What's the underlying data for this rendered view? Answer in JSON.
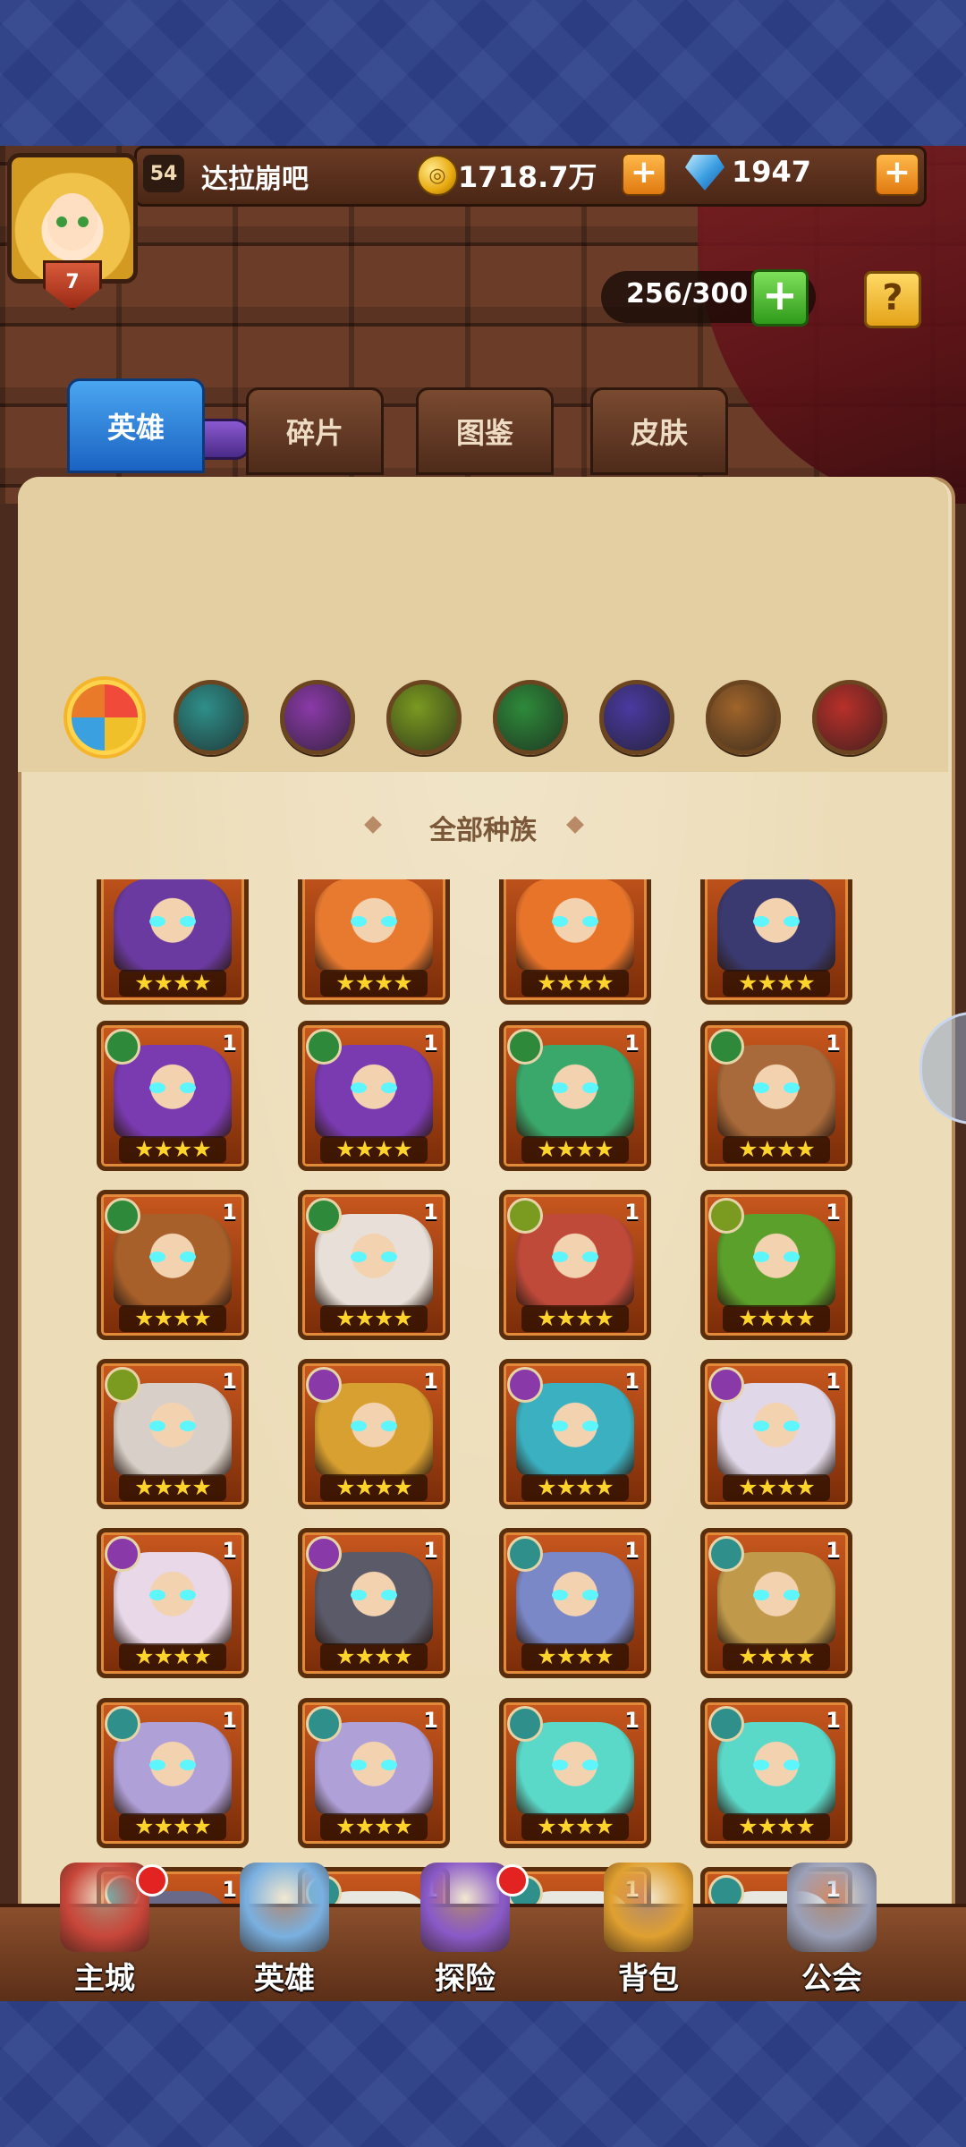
{
  "player": {
    "level": "54",
    "name": "达拉崩吧",
    "vip": "7"
  },
  "currency": {
    "gold": "1718.7万",
    "gems": "1947",
    "add_symbol": "+"
  },
  "hero_capacity": "256/300",
  "help_symbol": "?",
  "tabs": [
    {
      "label": "英雄",
      "active": true
    },
    {
      "label": "碎片",
      "active": false
    },
    {
      "label": "图鉴",
      "active": false
    },
    {
      "label": "皮肤",
      "active": false
    }
  ],
  "race_filters": [
    {
      "name": "all",
      "color": "#f07a2a",
      "selected": true
    },
    {
      "name": "race-1",
      "color": "#2f8f8a",
      "selected": false
    },
    {
      "name": "race-2",
      "color": "#8a3aa8",
      "selected": false
    },
    {
      "name": "race-3",
      "color": "#7a9a20",
      "selected": false
    },
    {
      "name": "race-4",
      "color": "#2e8a3a",
      "selected": false
    },
    {
      "name": "race-5",
      "color": "#4a3aa0",
      "selected": false
    },
    {
      "name": "race-6",
      "color": "#a0642a",
      "selected": false
    },
    {
      "name": "race-7",
      "color": "#b8302a",
      "selected": false
    }
  ],
  "filter_title": "全部种族",
  "hero_rows": [
    [
      {
        "race": "",
        "count": "",
        "stars": "★★★★",
        "color": "#6a3aa0"
      },
      {
        "race": "",
        "count": "",
        "stars": "★★★★",
        "color": "#e87a30"
      },
      {
        "race": "",
        "count": "",
        "stars": "★★★★",
        "color": "#e8742a"
      },
      {
        "race": "",
        "count": "",
        "stars": "★★★★",
        "color": "#3a3a70"
      }
    ],
    [
      {
        "race": "forest",
        "count": "1",
        "stars": "★★★★",
        "color": "#7a3ab0"
      },
      {
        "race": "forest",
        "count": "1",
        "stars": "★★★★",
        "color": "#7a3ab0"
      },
      {
        "race": "forest",
        "count": "1",
        "stars": "★★★★",
        "color": "#3aa86a"
      },
      {
        "race": "forest",
        "count": "1",
        "stars": "★★★★",
        "color": "#a86a3a"
      }
    ],
    [
      {
        "race": "forest",
        "count": "1",
        "stars": "★★★★",
        "color": "#a8602a"
      },
      {
        "race": "forest",
        "count": "1",
        "stars": "★★★★",
        "color": "#e8e0d8"
      },
      {
        "race": "fortress",
        "count": "1",
        "stars": "★★★★",
        "color": "#c04a3a"
      },
      {
        "race": "fortress",
        "count": "1",
        "stars": "★★★★",
        "color": "#5aa02a"
      }
    ],
    [
      {
        "race": "fortress",
        "count": "1",
        "stars": "★★★★",
        "color": "#d8d0c8"
      },
      {
        "race": "abyss",
        "count": "1",
        "stars": "★★★★",
        "color": "#d8a030"
      },
      {
        "race": "abyss",
        "count": "1",
        "stars": "★★★★",
        "color": "#3ab0c0"
      },
      {
        "race": "abyss",
        "count": "1",
        "stars": "★★★★",
        "color": "#e0d8e8"
      }
    ],
    [
      {
        "race": "abyss",
        "count": "1",
        "stars": "★★★★",
        "color": "#e8d8e8"
      },
      {
        "race": "abyss",
        "count": "1",
        "stars": "★★★★",
        "color": "#5a5a68"
      },
      {
        "race": "shadow",
        "count": "1",
        "stars": "★★★★",
        "color": "#7a88c8"
      },
      {
        "race": "shadow",
        "count": "1",
        "stars": "★★★★",
        "color": "#c09a4a"
      }
    ],
    [
      {
        "race": "shadow",
        "count": "1",
        "stars": "★★★★",
        "color": "#b0a0d8"
      },
      {
        "race": "shadow",
        "count": "1",
        "stars": "★★★★",
        "color": "#b0a0d8"
      },
      {
        "race": "shadow",
        "count": "1",
        "stars": "★★★★",
        "color": "#5ad8c8"
      },
      {
        "race": "shadow",
        "count": "1",
        "stars": "★★★★",
        "color": "#5ad8c8"
      }
    ],
    [
      {
        "race": "shadow",
        "count": "1",
        "stars": "★★★★",
        "color": "#6a6a88"
      },
      {
        "race": "shadow",
        "count": "1",
        "stars": "★★★★",
        "color": "#e8e8e0"
      },
      {
        "race": "shadow",
        "count": "1",
        "stars": "★★★★",
        "color": "#e8e8e0"
      },
      {
        "race": "shadow",
        "count": "1",
        "stars": "★★★★",
        "color": "#e8e8e0"
      }
    ]
  ],
  "bottom_nav": [
    {
      "label": "主城",
      "icon": "castle-icon",
      "color": "#c8463a",
      "badge": true
    },
    {
      "label": "英雄",
      "icon": "hero-icon",
      "color": "#7ab0e0",
      "badge": false
    },
    {
      "label": "探险",
      "icon": "portal-icon",
      "color": "#8a5ac8",
      "badge": true
    },
    {
      "label": "背包",
      "icon": "backpack-icon",
      "color": "#e0a030",
      "badge": false
    },
    {
      "label": "公会",
      "icon": "guild-tower-icon",
      "color": "#9aa0b8",
      "badge": false
    }
  ]
}
